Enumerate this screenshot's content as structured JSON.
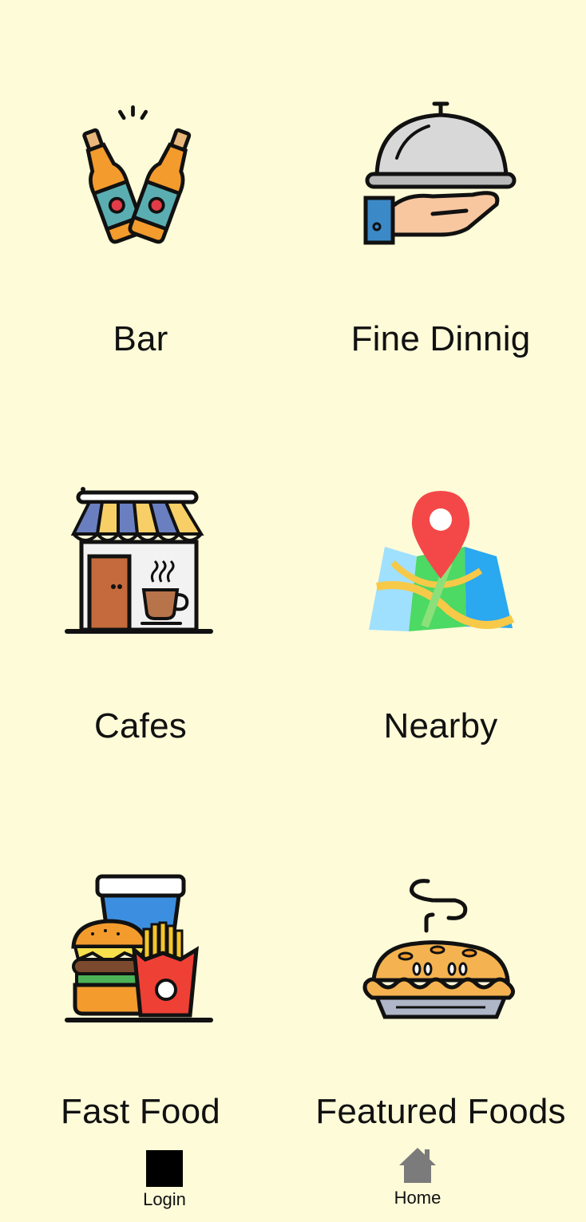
{
  "tiles": [
    {
      "label": "Bar",
      "icon": "beer-bottles-icon"
    },
    {
      "label": "Fine Dinnig",
      "icon": "cloche-platter-icon"
    },
    {
      "label": "Cafes",
      "icon": "cafe-storefront-icon"
    },
    {
      "label": "Nearby",
      "icon": "map-pin-icon"
    },
    {
      "label": "Fast Food",
      "icon": "burger-fries-drink-icon"
    },
    {
      "label": "Featured Foods",
      "icon": "pie-icon"
    }
  ],
  "bottom_nav": {
    "login": {
      "label": "Login",
      "icon": "square-icon"
    },
    "home": {
      "label": "Home",
      "icon": "home-icon"
    }
  },
  "colors": {
    "background": "#fefbd8",
    "nav_home_icon": "#7b7b7b",
    "text": "#111111"
  }
}
